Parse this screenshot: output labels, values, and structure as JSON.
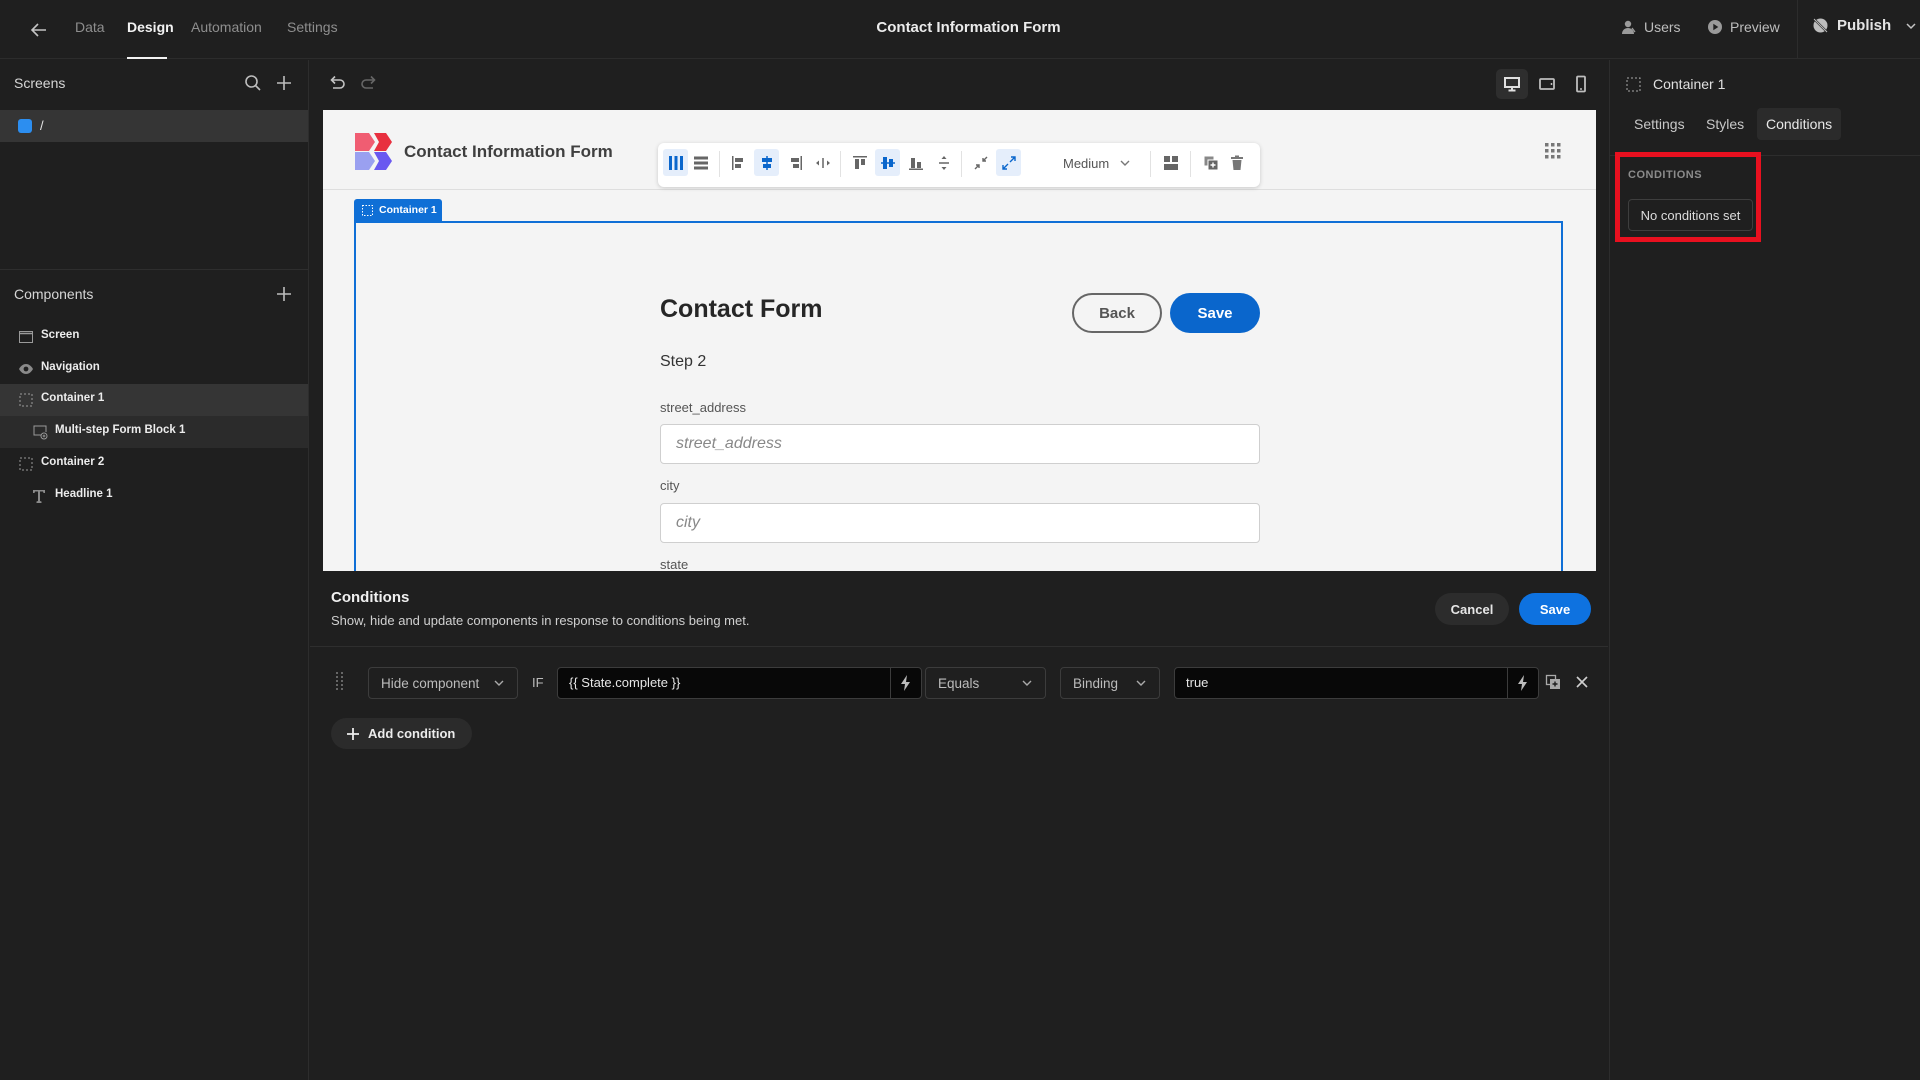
{
  "topbar": {
    "nav_tabs": [
      {
        "label": "Data",
        "active": false
      },
      {
        "label": "Design",
        "active": true
      },
      {
        "label": "Automation",
        "active": false
      },
      {
        "label": "Settings",
        "active": false
      }
    ],
    "app_title": "Contact Information Form",
    "users_label": "Users",
    "preview_label": "Preview",
    "publish_label": "Publish"
  },
  "left_panel": {
    "screens_heading": "Screens",
    "screens": [
      {
        "route": "/",
        "color": "#2c8ef0"
      }
    ],
    "components_heading": "Components",
    "components": [
      {
        "label": "Screen",
        "icon": "screen-icon",
        "level": 0
      },
      {
        "label": "Navigation",
        "icon": "eye-icon",
        "level": 0
      },
      {
        "label": "Container 1",
        "icon": "container-icon",
        "level": 0,
        "selected": true
      },
      {
        "label": "Multi-step Form Block 1",
        "icon": "form-block-icon",
        "level": 1
      },
      {
        "label": "Container 2",
        "icon": "container-icon",
        "level": 0
      },
      {
        "label": "Headline 1",
        "icon": "text-icon",
        "level": 1
      }
    ]
  },
  "canvas": {
    "site_title": "Contact Information Form",
    "toolbar": {
      "size_option": "Medium"
    },
    "selected_label": "Container 1",
    "form": {
      "title": "Contact Form",
      "back_label": "Back",
      "save_label": "Save",
      "step_label": "Step 2",
      "fields": [
        {
          "label": "street_address",
          "placeholder": "street_address"
        },
        {
          "label": "city",
          "placeholder": "city"
        },
        {
          "label": "state",
          "placeholder": ""
        }
      ]
    }
  },
  "conditions_panel": {
    "title": "Conditions",
    "subtitle": "Show, hide and update components in response to conditions being met.",
    "cancel_label": "Cancel",
    "save_label": "Save",
    "rows": [
      {
        "action": "Hide component",
        "if_label": "IF",
        "left_value": "{{ State.complete }}",
        "operator": "Equals",
        "value_type": "Binding",
        "right_value": "true"
      }
    ],
    "add_label": "Add condition"
  },
  "right_panel": {
    "component_name": "Container 1",
    "tabs": [
      {
        "label": "Settings",
        "active": false
      },
      {
        "label": "Styles",
        "active": false
      },
      {
        "label": "Conditions",
        "active": true
      }
    ],
    "section_label": "CONDITIONS",
    "no_conditions_label": "No conditions set",
    "highlight_color": "#e8101f"
  },
  "colors": {
    "accent": "#0f6fd6",
    "primary_button": "#0e72e0"
  }
}
